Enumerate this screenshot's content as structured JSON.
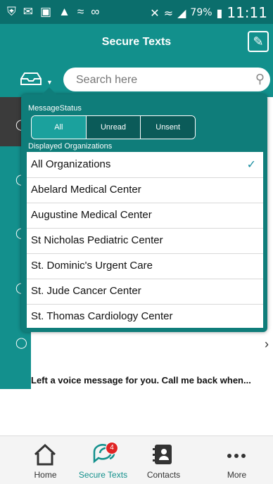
{
  "status_bar": {
    "battery": "79%",
    "time": "11:11"
  },
  "header": {
    "title": "Secure Texts"
  },
  "search": {
    "placeholder": "Search here"
  },
  "filter_panel": {
    "status_label": "MessageStatus",
    "status_options": [
      "All",
      "Unread",
      "Unsent"
    ],
    "selected_status": "All",
    "orgs_label": "Displayed Organizations",
    "organizations": [
      "All Organizations",
      "Abelard Medical Center",
      "Augustine Medical Center",
      "St Nicholas Pediatric Center",
      "St. Dominic's Urgent Care",
      "St. Jude Cancer Center",
      "St. Thomas Cardiology Center"
    ],
    "selected_organization": "All Organizations"
  },
  "message_preview": {
    "text": "Left a voice message for you. Call me back when..."
  },
  "tabs": [
    {
      "label": "Home"
    },
    {
      "label": "Secure Texts",
      "badge": "4"
    },
    {
      "label": "Contacts"
    },
    {
      "label": "More"
    }
  ],
  "colors": {
    "primary": "#12908c",
    "status_bar": "#0b6e6c",
    "badge": "#e02424"
  }
}
